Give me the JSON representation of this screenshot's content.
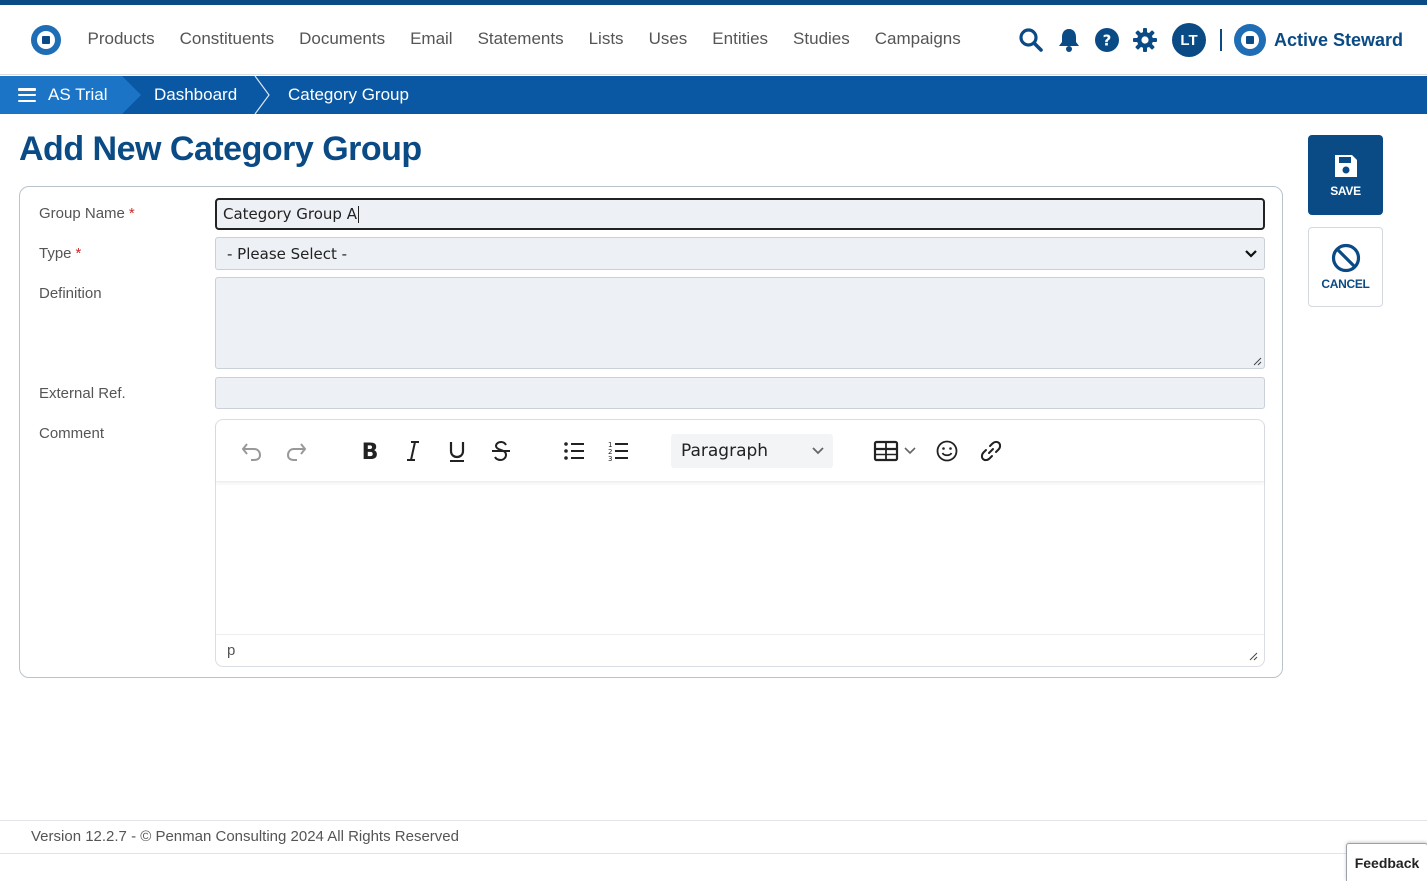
{
  "colors": {
    "brand": "#0a4a85",
    "breadcrumb_bg": "#0a58a3",
    "breadcrumb_first": "#1b74c5",
    "required": "#c9282d"
  },
  "nav": {
    "items": [
      "Products",
      "Constituents",
      "Documents",
      "Email",
      "Statements",
      "Lists",
      "Uses",
      "Entities",
      "Studies",
      "Campaigns"
    ],
    "icons": [
      "search-icon",
      "bell-icon",
      "help-icon",
      "gear-icon"
    ],
    "avatar": "LT",
    "brand": "Active Steward"
  },
  "breadcrumb": {
    "root": "AS Trial",
    "items": [
      "Dashboard",
      "Category Group"
    ]
  },
  "page": {
    "title": "Add New Category Group"
  },
  "form": {
    "group_name": {
      "label": "Group Name",
      "required_mark": "*",
      "value": "Category Group A"
    },
    "type": {
      "label": "Type",
      "required_mark": "*",
      "selected": "- Please Select -"
    },
    "definition": {
      "label": "Definition",
      "value": ""
    },
    "external_ref": {
      "label": "External Ref.",
      "value": ""
    },
    "comment": {
      "label": "Comment",
      "format_dropdown": "Paragraph",
      "status_path": "p"
    }
  },
  "actions": {
    "save": "SAVE",
    "cancel": "CANCEL"
  },
  "footer": {
    "text": "Version 12.2.7 - © Penman Consulting 2024 All Rights Reserved",
    "feedback": "Feedback"
  }
}
